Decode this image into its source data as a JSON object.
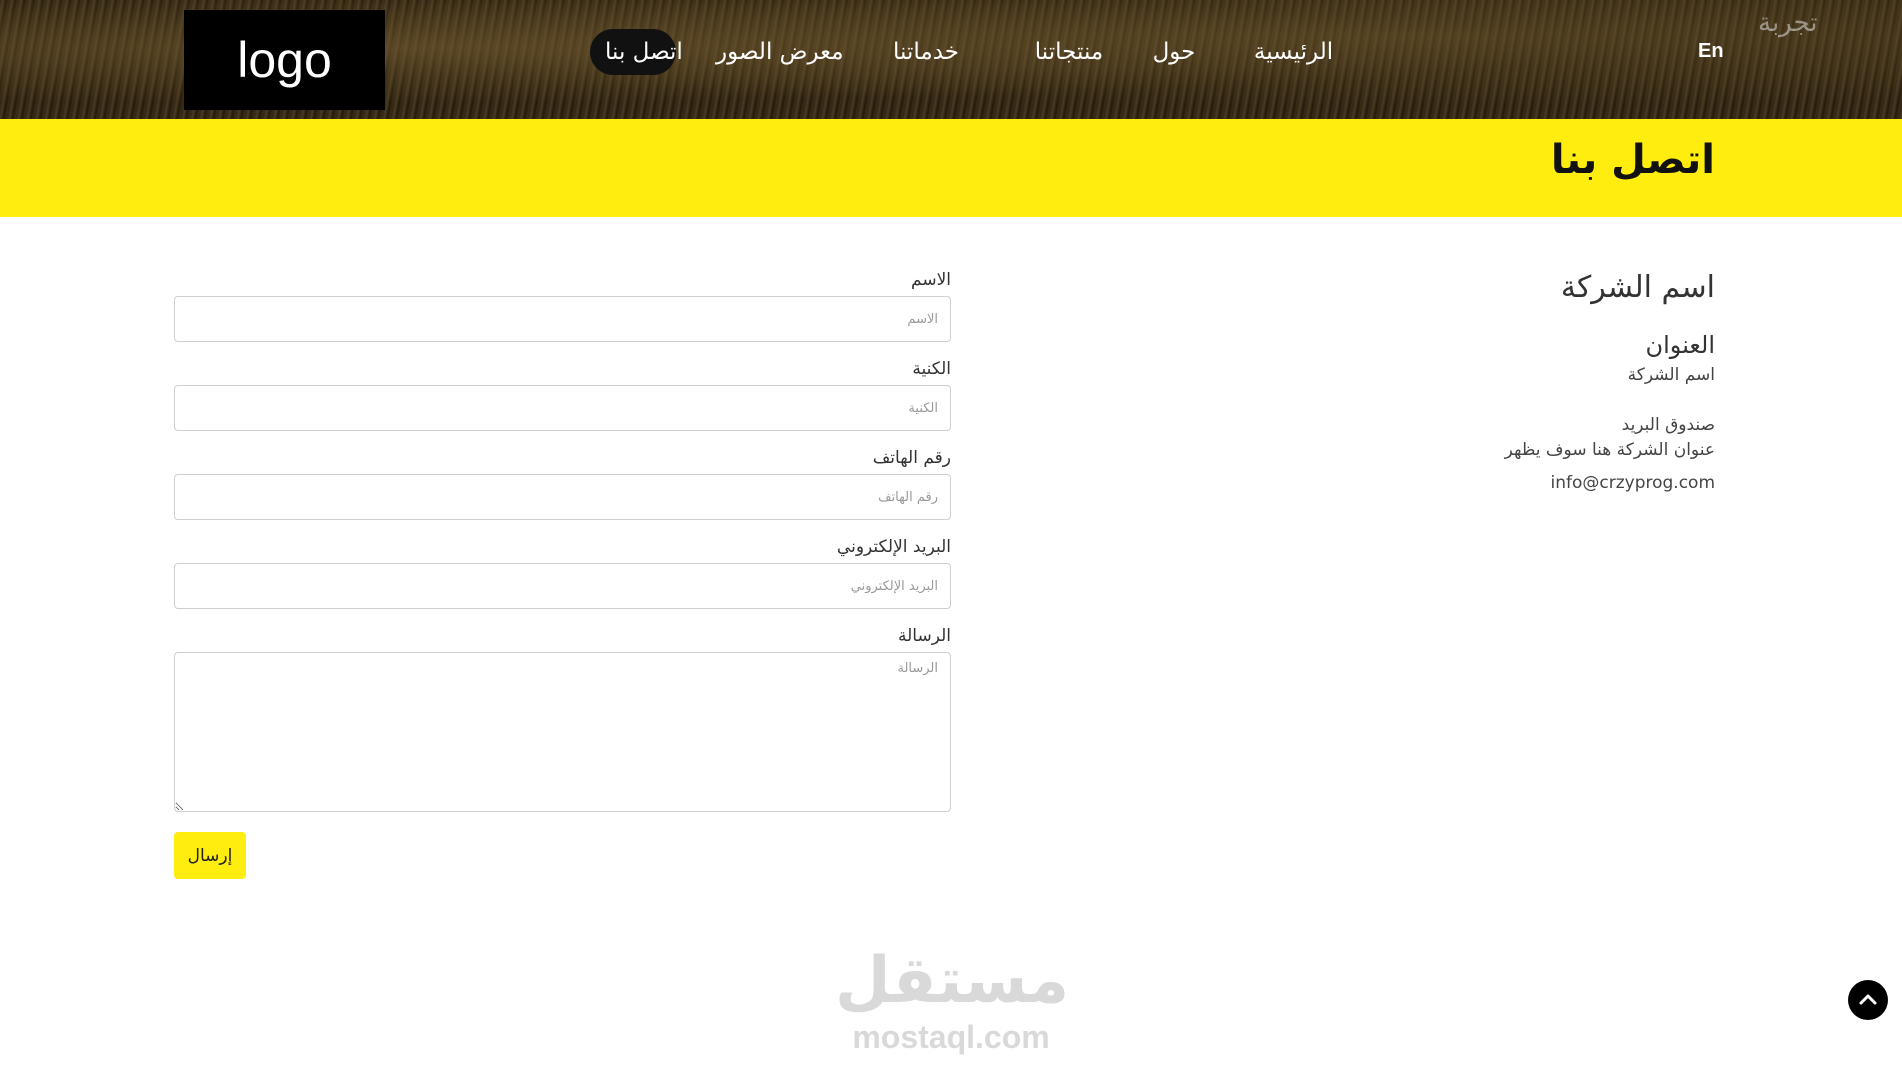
{
  "header": {
    "logo_text": "logo",
    "nav": [
      {
        "label": "الرئيسية"
      },
      {
        "label": "حول"
      },
      {
        "label": "منتجاتنا"
      },
      {
        "label": "خدماتنا"
      },
      {
        "label": "معرض الصور"
      },
      {
        "label": "اتصل بنا",
        "active": true
      }
    ],
    "lang_label": "En",
    "brand_text": "تجربة"
  },
  "banner": {
    "title": "اتصل بنا",
    "color": "#feed0e"
  },
  "info": {
    "company_name": "اسم الشركة",
    "address_heading": "العنوان",
    "address_line": "اسم الشركة",
    "pobox_label": "صندوق البريد",
    "pobox_value": "عنوان الشركة هنا سوف يظهر",
    "email": "info@crzyprog.com"
  },
  "form": {
    "name": {
      "label": "الاسم",
      "placeholder": "الاسم"
    },
    "surname": {
      "label": "الكنية",
      "placeholder": "الكنية"
    },
    "phone": {
      "label": "رقم الهاتف",
      "placeholder": "رقم الهاتف"
    },
    "email": {
      "label": "البريد الإلكتروني",
      "placeholder": "البريد الإلكتروني"
    },
    "message": {
      "label": "الرسالة",
      "placeholder": "الرسالة"
    },
    "submit_label": "إرسال"
  },
  "watermark": {
    "arabic": "مستقل",
    "latin": "mostaql.com"
  },
  "scroll_top": {
    "icon": "chevron-up-icon"
  }
}
